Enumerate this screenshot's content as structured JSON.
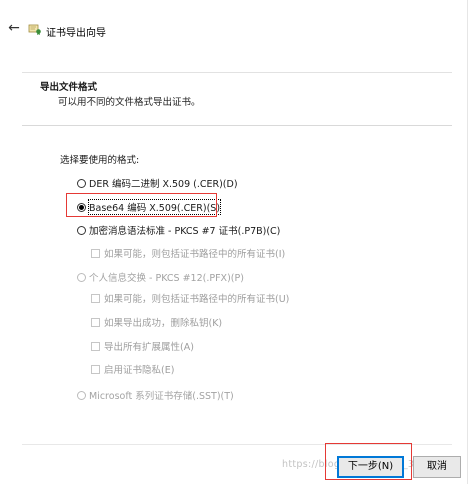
{
  "header": {
    "back_glyph": "←",
    "title": "证书导出向导"
  },
  "section": {
    "title": "导出文件格式",
    "subtitle": "可以用不同的文件格式导出证书。"
  },
  "format_label": "选择要使用的格式:",
  "options": {
    "der": "DER 编码二进制 X.509 (.CER)(D)",
    "base64": "Base64 编码 X.509(.CER)(S)",
    "pkcs7": "加密消息语法标准 - PKCS #7 证书(.P7B)(C)",
    "pkcs7_include_all": "如果可能，则包括证书路径中的所有证书(I)",
    "pfx": "个人信息交换 - PKCS #12(.PFX)(P)",
    "pfx_include_all": "如果可能，则包括证书路径中的所有证书(U)",
    "pfx_delete_key": "如果导出成功，删除私钥(K)",
    "pfx_export_ext": "导出所有扩展属性(A)",
    "pfx_enable_privacy": "启用证书隐私(E)",
    "sst": "Microsoft 系列证书存储(.SST)(T)"
  },
  "buttons": {
    "next": "下一步(N)",
    "cancel": "取消"
  },
  "watermark": "https://blog.csdn.net/qq_3...",
  "selected_option": "base64",
  "colors": {
    "highlight_red": "#e53935",
    "focus_blue": "#0078d7"
  }
}
